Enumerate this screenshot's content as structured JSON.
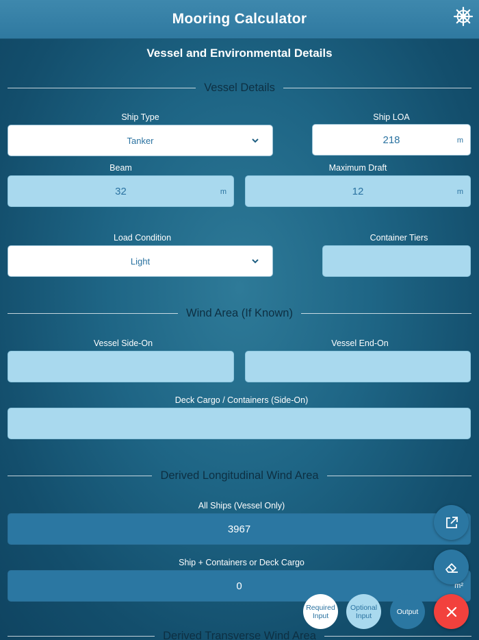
{
  "header": {
    "title": "Mooring Calculator",
    "settings_icon": "ship-wheel-icon"
  },
  "subtitle": "Vessel and Environmental Details",
  "sections": {
    "vessel_details": "Vessel Details",
    "wind_area": "Wind Area (If Known)",
    "derived_longitudinal": "Derived Longitudinal Wind Area",
    "derived_transverse": "Derived Transverse Wind Area"
  },
  "fields": {
    "ship_type": {
      "label": "Ship Type",
      "value": "Tanker"
    },
    "ship_loa": {
      "label": "Ship LOA",
      "value": "218",
      "unit": "m"
    },
    "beam": {
      "label": "Beam",
      "value": "32",
      "unit": "m"
    },
    "max_draft": {
      "label": "Maximum Draft",
      "value": "12",
      "unit": "m"
    },
    "load_condition": {
      "label": "Load Condition",
      "value": "Light"
    },
    "container_tiers": {
      "label": "Container Tiers",
      "value": ""
    },
    "vessel_side_on": {
      "label": "Vessel Side-On",
      "value": ""
    },
    "vessel_end_on": {
      "label": "Vessel End-On",
      "value": ""
    },
    "deck_cargo_side_on": {
      "label": "Deck Cargo / Containers (Side-On)",
      "value": ""
    },
    "all_ships": {
      "label": "All Ships (Vessel Only)",
      "value": "3967"
    },
    "ship_containers": {
      "label": "Ship + Containers or Deck Cargo",
      "value": "0",
      "unit": "m²"
    }
  },
  "legend": {
    "required": "Required Input",
    "optional": "Optional Input",
    "output": "Output"
  },
  "colors": {
    "required": "#ffffff",
    "optional": "#a9d9ee",
    "output": "#2b77a2",
    "close": "#f2413d"
  },
  "icons": [
    "ship-wheel-icon",
    "chevron-down-icon",
    "share-icon",
    "eraser-icon",
    "close-icon"
  ]
}
